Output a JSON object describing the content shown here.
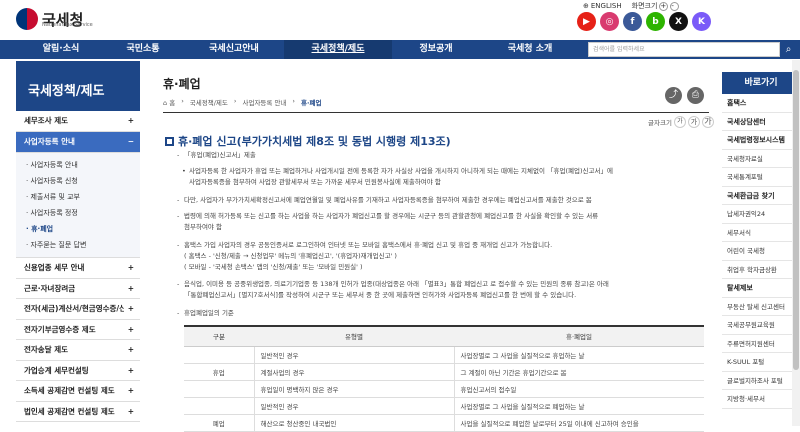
{
  "header": {
    "logo_text": "국세청",
    "logo_sub": "National Tax Service",
    "english_label": "ENGLISH",
    "zoom_label": "화면크기",
    "zoom_plus": "+",
    "zoom_minus": "-"
  },
  "sns": [
    {
      "name": "youtube",
      "glyph": "▶",
      "color": "#e62117"
    },
    {
      "name": "instagram",
      "glyph": "◎",
      "color": "#d93a6f"
    },
    {
      "name": "facebook",
      "glyph": "f",
      "color": "#3b5998"
    },
    {
      "name": "blog",
      "glyph": "b",
      "color": "#2db400"
    },
    {
      "name": "x",
      "glyph": "X",
      "color": "#111111"
    },
    {
      "name": "kakao",
      "glyph": "K",
      "color": "#7a5af8"
    }
  ],
  "nav": {
    "items": [
      "알림·소식",
      "국민소통",
      "국세신고안내",
      "국세정책/제도",
      "정보공개",
      "국세청 소개"
    ],
    "active_index": 3,
    "search_placeholder": "검색어를 입력하세요"
  },
  "sidebar": {
    "title": "국세정책/제도",
    "items": [
      {
        "label": "세무조사 제도",
        "sign": "+"
      },
      {
        "label": "사업자등록 안내",
        "sign": "−",
        "active": true
      }
    ],
    "subitems": [
      "사업자등록 안내",
      "사업자등록 신청",
      "제출서류 및 교부",
      "사업자등록 정정",
      "휴·폐업",
      "자주묻는 질문 답변"
    ],
    "current_sub": 4,
    "more_items": [
      {
        "label": "신용업종 세무 안내",
        "sign": "+"
      },
      {
        "label": "근로·자녀장려금",
        "sign": "+"
      },
      {
        "label": "전자(세금)계산서/현금영수증/신용카드",
        "sign": "+"
      },
      {
        "label": "전자기부금영수증 제도",
        "sign": "+"
      },
      {
        "label": "전자송달 제도",
        "sign": "+"
      },
      {
        "label": "가업승계 세무컨설팅",
        "sign": "+"
      },
      {
        "label": "소득세 공제감면 컨설팅 제도",
        "sign": "+"
      },
      {
        "label": "법인세 공제감면 컨설팅 제도",
        "sign": "+"
      }
    ]
  },
  "content": {
    "title": "휴·폐업",
    "breadcrumb": [
      "홈",
      "국세정책/제도",
      "사업자등록 안내",
      "휴·폐업"
    ],
    "font_size_label": "글자크기",
    "font_size_btns": [
      "가",
      "가",
      "가"
    ],
    "section_title": "휴·폐업 신고(부가가치세법 제8조 및 동법 시행령 제13조)",
    "p1": "「휴업(폐업)신고서」제출",
    "p1a": "사업자등록 한 사업자가 휴업 또는 폐업하거나 사업개시일 전에 등록한 자가 사실상 사업을 개시하지 아니하게 되는 때에는 지체없이 「휴업(폐업)신고서」에",
    "p1b": "사업자등록증을 첨부하여 사업장 관할세무서 또는 가까운 세무서 민원봉사실에 제출하여야 함",
    "p2": "다만, 사업자가 부가가치세확정신고서에 폐업연월일 및 폐업사유를 기재하고 사업자등록증을 첨부하여 제출한 경우에는 폐업신고서를 제출한 것으로 봄",
    "p3a": "법령에 의해 허가등록 또는 신고를 하는 사업을 하는 사업자가 폐업신고를 할 경우에는 시군구 등의 관할관청에 폐업신고를 한 사실을 확인할 수 있는 서류",
    "p3b": "첨부하여야 함",
    "p4": "홈택스 가입 사업자의 경우 공동인증서로 로그인하여 인터넷 또는 모바일 홈택스에서 휴·폐업 신고 및 휴업 중 재개업 신고가 가능합니다.",
    "p4a": "( 홈택스 - '신청/제출 → 신청업무' 메뉴의 '휴폐업신고', '(휴업자)재개업신고' )",
    "p4b": "( 모바일 - '국세청 손택스' 앱의 '신청/제출' 또는 '모바일 민원실' )",
    "p5a": "음식업, 이미용 등 공중위생업종, 의료기기업종 등 138개 인허가 업종(대상업종은 아래 「별표3」통합 폐업신고 로 접수할 수 있는 민원의 종류 참고)은 아래",
    "p5b": "「통합폐업신고서」[별지7호서식]를 작성하여 시군구 또는 세무서 중 한 곳에 제출하면 인허가와 사업자등록 폐업신고를 한 번에 할 수 있습니다.",
    "p6": "휴업폐업일의 기준"
  },
  "table": {
    "headers": [
      "구분",
      "유형별",
      "휴·폐업일"
    ],
    "rows": [
      [
        "",
        "일반적인 경우",
        "사업장별로 그 사업을 실질적으로 휴업하는 날"
      ],
      [
        "휴업",
        "계절사업의 경우",
        "그 계절이 아닌 기간은 휴업기간으로 봄"
      ],
      [
        "",
        "휴업일이 명백하지 않은 경우",
        "휴업신고서의 접수일"
      ],
      [
        "",
        "일반적인 경우",
        "사업장별로 그 사업을 실질적으로 폐업하는 날"
      ],
      [
        "폐업",
        "해산으로 청산중인 내국법인",
        "사업을 실질적으로 폐업한 날로부터 25일 이내에 신고하여 승인을"
      ]
    ]
  },
  "right": {
    "title": "바로가기",
    "items": [
      {
        "label": "홈택스",
        "bold": true
      },
      {
        "label": "국세상담센터",
        "bold": true
      },
      {
        "label": "국세법령정보시스템",
        "bold": true
      },
      {
        "label": "국세청자료실",
        "bold": false
      },
      {
        "label": "국세통계포털",
        "bold": false
      },
      {
        "label": "국세환급금 찾기",
        "bold": true
      },
      {
        "label": "납세자권익24",
        "bold": false
      },
      {
        "label": "세무서식",
        "bold": false
      },
      {
        "label": "어린이 국세청",
        "bold": false
      },
      {
        "label": "취업후 학자금상환",
        "bold": false
      },
      {
        "label": "탈세제보",
        "bold": true
      },
      {
        "label": "부동산 탈세 신고센터",
        "bold": false
      },
      {
        "label": "국세공무원교육원",
        "bold": false
      },
      {
        "label": "주류면허지원센터",
        "bold": false
      },
      {
        "label": "K-SUUL 포털",
        "bold": false
      },
      {
        "label": "글로벌지하조사 포털",
        "bold": false
      },
      {
        "label": "지방청·세무서",
        "bold": false
      }
    ]
  }
}
